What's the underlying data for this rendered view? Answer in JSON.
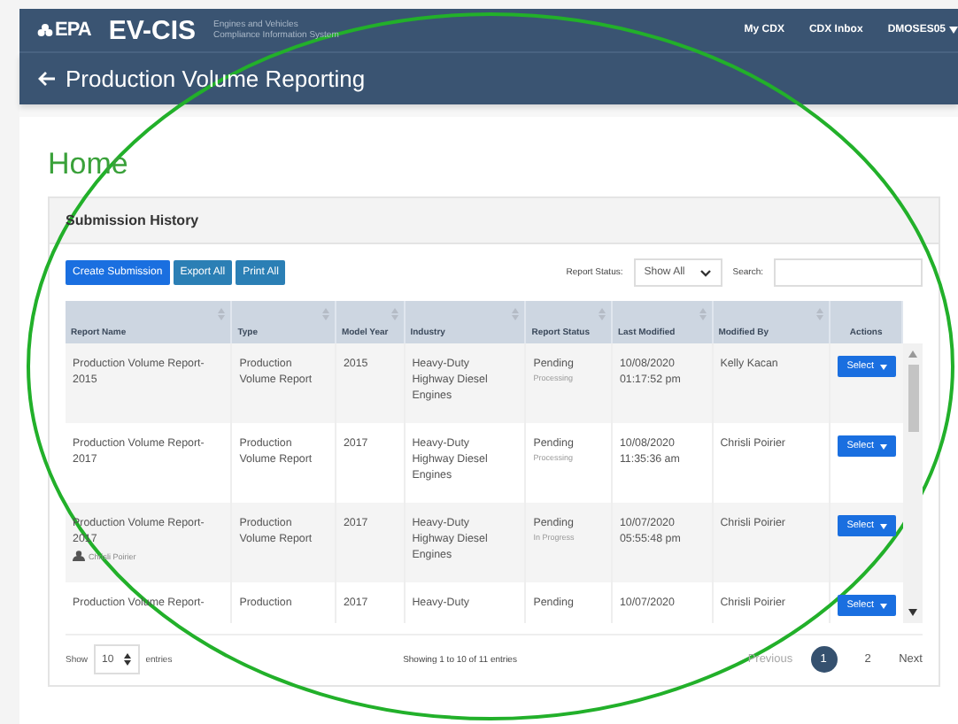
{
  "header": {
    "logo": "EPA",
    "app": "EV-CIS",
    "subtitle": "Engines and Vehicles Compliance Information System",
    "nav": [
      "My CDX",
      "CDX Inbox",
      "DMOSES05"
    ]
  },
  "page_title": "Production Volume Reporting",
  "heading": "Home",
  "card": {
    "title": "Submission History",
    "buttons": [
      {
        "label": "Create Submission",
        "kind": "primary"
      },
      {
        "label": "Export All",
        "kind": "secondary"
      },
      {
        "label": "Print All",
        "kind": "secondary"
      }
    ],
    "status_filter": {
      "label": "Report Status:",
      "value": "Show All"
    },
    "search": {
      "label": "Search:"
    },
    "table": {
      "columns": [
        "Report Name",
        "Type",
        "Model Year",
        "Industry",
        "Report Status",
        "Last Modified",
        "Modified By",
        "Actions"
      ],
      "rows": [
        {
          "name": [
            "Production Volume Report-",
            "2015"
          ],
          "type": [
            "Production",
            "Volume Report"
          ],
          "year": "2015",
          "industry": [
            "Heavy-Duty",
            "Highway Diesel",
            "Engines"
          ],
          "status": "Pending",
          "substatus": "Processing",
          "modified": [
            "10/08/2020",
            "01:17:52 pm"
          ],
          "by": "Kelly Kacan",
          "action": "Select"
        },
        {
          "name": [
            "Production Volume Report-",
            "2017"
          ],
          "type": [
            "Production",
            "Volume Report"
          ],
          "year": "2017",
          "industry": [
            "Heavy-Duty",
            "Highway Diesel",
            "Engines"
          ],
          "status": "Pending",
          "substatus": "Processing",
          "modified": [
            "10/08/2020",
            "11:35:36 am"
          ],
          "by": "Chrisli Poirier",
          "action": "Select"
        },
        {
          "name": [
            "Production Volume Report-",
            "2017"
          ],
          "locked_by": "Chrisli Poirier",
          "type": [
            "Production",
            "Volume Report"
          ],
          "year": "2017",
          "industry": [
            "Heavy-Duty",
            "Highway Diesel",
            "Engines"
          ],
          "status": "Pending",
          "substatus": "In Progress",
          "modified": [
            "10/07/2020",
            "05:55:48 pm"
          ],
          "by": "Chrisli Poirier",
          "action": "Select"
        },
        {
          "name": [
            "Production Volume Report-"
          ],
          "type": [
            "Production"
          ],
          "year": "2017",
          "industry": [
            "Heavy-Duty"
          ],
          "status": "Pending",
          "modified": [
            "10/07/2020"
          ],
          "by": "Chrisli Poirier",
          "action": "Select"
        }
      ]
    },
    "length": {
      "before": "Show",
      "value": "10",
      "after": "entries"
    },
    "info": "Showing 1 to 10 of 11 entries",
    "pagination": [
      {
        "label": "Previous",
        "kind": "nav",
        "disabled": true,
        "selected": false
      },
      {
        "label": "1",
        "kind": "page",
        "disabled": false,
        "selected": true
      },
      {
        "label": "2",
        "kind": "page",
        "disabled": false,
        "selected": false
      },
      {
        "label": "Next",
        "kind": "nav",
        "disabled": false,
        "selected": false
      }
    ]
  }
}
